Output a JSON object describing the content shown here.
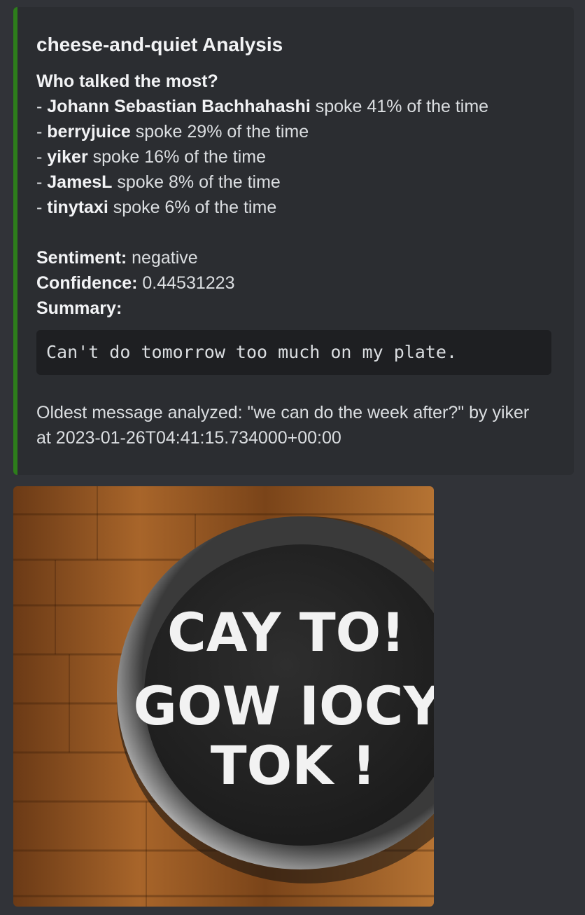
{
  "embed": {
    "accent_color": "#2d7d1b",
    "title": "cheese-and-quiet Analysis",
    "who_heading": "Who talked the most?",
    "speakers": [
      {
        "prefix": "- ",
        "name": "Johann Sebastian Bachhahashi",
        "text": " spoke 41% of the time"
      },
      {
        "prefix": "- ",
        "name": "berryjuice",
        "text": " spoke 29% of the time"
      },
      {
        "prefix": "- ",
        "name": "yiker",
        "text": " spoke 16% of the time"
      },
      {
        "prefix": "- ",
        "name": "JamesL",
        "text": " spoke 8% of the time"
      },
      {
        "prefix": "- ",
        "name": "tinytaxi",
        "text": " spoke 6% of the time"
      }
    ],
    "sentiment_label": "Sentiment:",
    "sentiment_value": " negative",
    "confidence_label": "Confidence:",
    "confidence_value": " 0.44531223",
    "summary_label": "Summary:",
    "summary_code": "Can't do tomorrow too much on my plate.",
    "oldest_message": "Oldest message analyzed: \"we can do the week after?\" by yiker at 2023-01-26T04:41:15.734000+00:00"
  },
  "image": {
    "plate_text_lines": [
      "CAY TO!",
      "GOW IOCY",
      "TOK !"
    ]
  }
}
